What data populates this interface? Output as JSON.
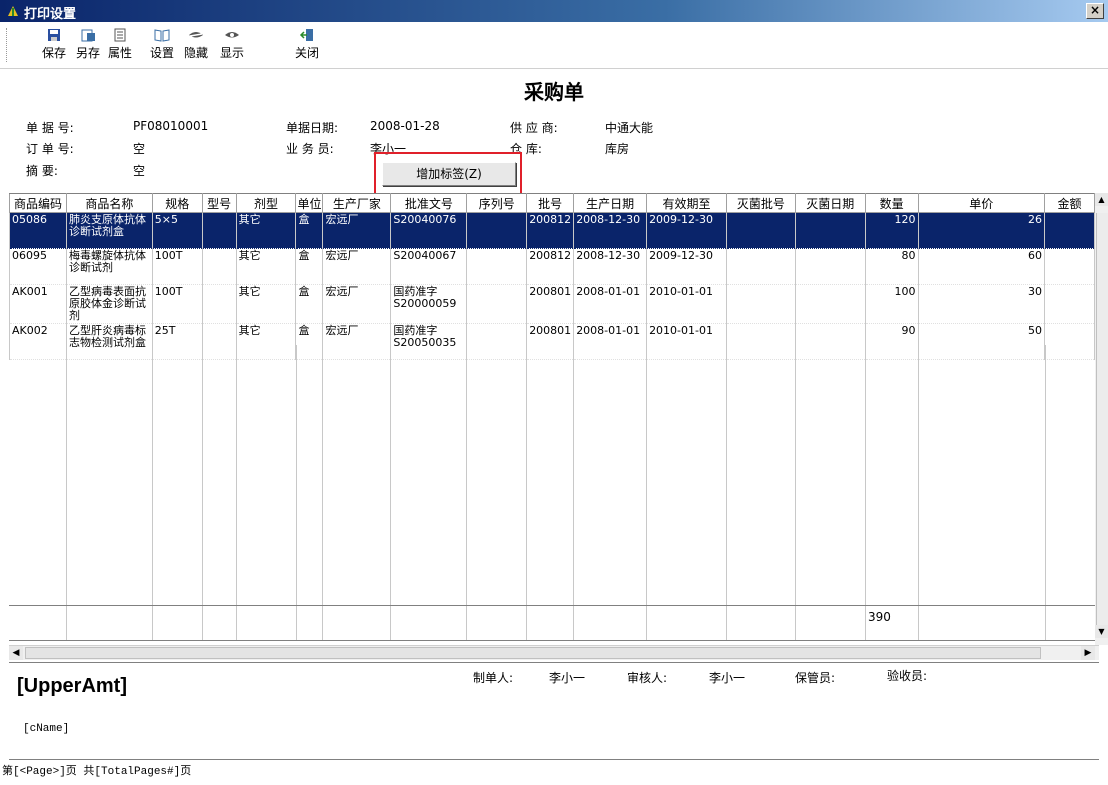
{
  "window": {
    "title": "打印设置",
    "close": "×"
  },
  "toolbar": {
    "save": "保存",
    "save_as": "另存",
    "properties": "属性",
    "settings": "设置",
    "hide": "隐藏",
    "show": "显示",
    "close": "关闭"
  },
  "doc": {
    "title": "采购单"
  },
  "header": {
    "bill_no_label": "单 据 号:",
    "bill_no": "PF08010001",
    "order_no_label": "订 单 号:",
    "order_no": "空",
    "memo_label": "摘    要:",
    "memo": "空",
    "date_label": "单据日期:",
    "date": "2008-01-28",
    "clerk_label": "业 务 员:",
    "clerk": "李小一",
    "supplier_label": "供 应 商:",
    "supplier": "中通大能",
    "warehouse_label": "仓    库:",
    "warehouse": "库房"
  },
  "popup": {
    "add_label": "增加标签(Z)"
  },
  "grid": {
    "columns": [
      "商品编码",
      "商品名称",
      "规格",
      "型号",
      "剂型",
      "单位",
      "生产厂家",
      "批准文号",
      "序列号",
      "批号",
      "生产日期",
      "有效期至",
      "灭菌批号",
      "灭菌日期",
      "数量",
      "单价",
      "金额"
    ],
    "rows": [
      {
        "code": "05086",
        "name": "肺炎支原体抗体诊断试剂盒",
        "spec": "5×5",
        "model": "",
        "form": "其它",
        "unit": "盒",
        "maker": "宏远厂",
        "approval": "S20040076",
        "serial": "",
        "batch": "200812",
        "mfg": "2008-12-30",
        "exp": "2009-12-30",
        "sbatch": "",
        "sdate": "",
        "qty": "120",
        "price": "26",
        "amount": ""
      },
      {
        "code": "06095",
        "name": "梅毒螺旋体抗体诊断试剂",
        "spec": "100T",
        "model": "",
        "form": "其它",
        "unit": "盒",
        "maker": "宏远厂",
        "approval": "S20040067",
        "serial": "",
        "batch": "200812",
        "mfg": "2008-12-30",
        "exp": "2009-12-30",
        "sbatch": "",
        "sdate": "",
        "qty": "80",
        "price": "60",
        "amount": ""
      },
      {
        "code": "AK001",
        "name": "乙型病毒表面抗原胶体金诊断试剂",
        "spec": "100T",
        "model": "",
        "form": "其它",
        "unit": "盒",
        "maker": "宏远厂",
        "approval": "国药准字S20000059",
        "serial": "",
        "batch": "200801",
        "mfg": "2008-01-01",
        "exp": "2010-01-01",
        "sbatch": "",
        "sdate": "",
        "qty": "100",
        "price": "30",
        "amount": ""
      },
      {
        "code": "AK002",
        "name": "乙型肝炎病毒标志物检测试剂盒",
        "spec": "25T",
        "model": "",
        "form": "其它",
        "unit": "盒",
        "maker": "宏远厂",
        "approval": "国药准字S20050035",
        "serial": "",
        "batch": "200801",
        "mfg": "2008-01-01",
        "exp": "2010-01-01",
        "sbatch": "",
        "sdate": "",
        "qty": "90",
        "price": "50",
        "amount": ""
      }
    ],
    "total_qty": "390"
  },
  "footer": {
    "upper_amt": "[UpperAmt]",
    "cname": "[cName]",
    "maker_label": "制单人:",
    "maker": "李小一",
    "auditor_label": "审核人:",
    "auditor": "李小一",
    "keeper_label": "保管员:",
    "receiver_label": "验收员:"
  },
  "page_line": "第[<Page>]页 共[TotalPages#]页"
}
